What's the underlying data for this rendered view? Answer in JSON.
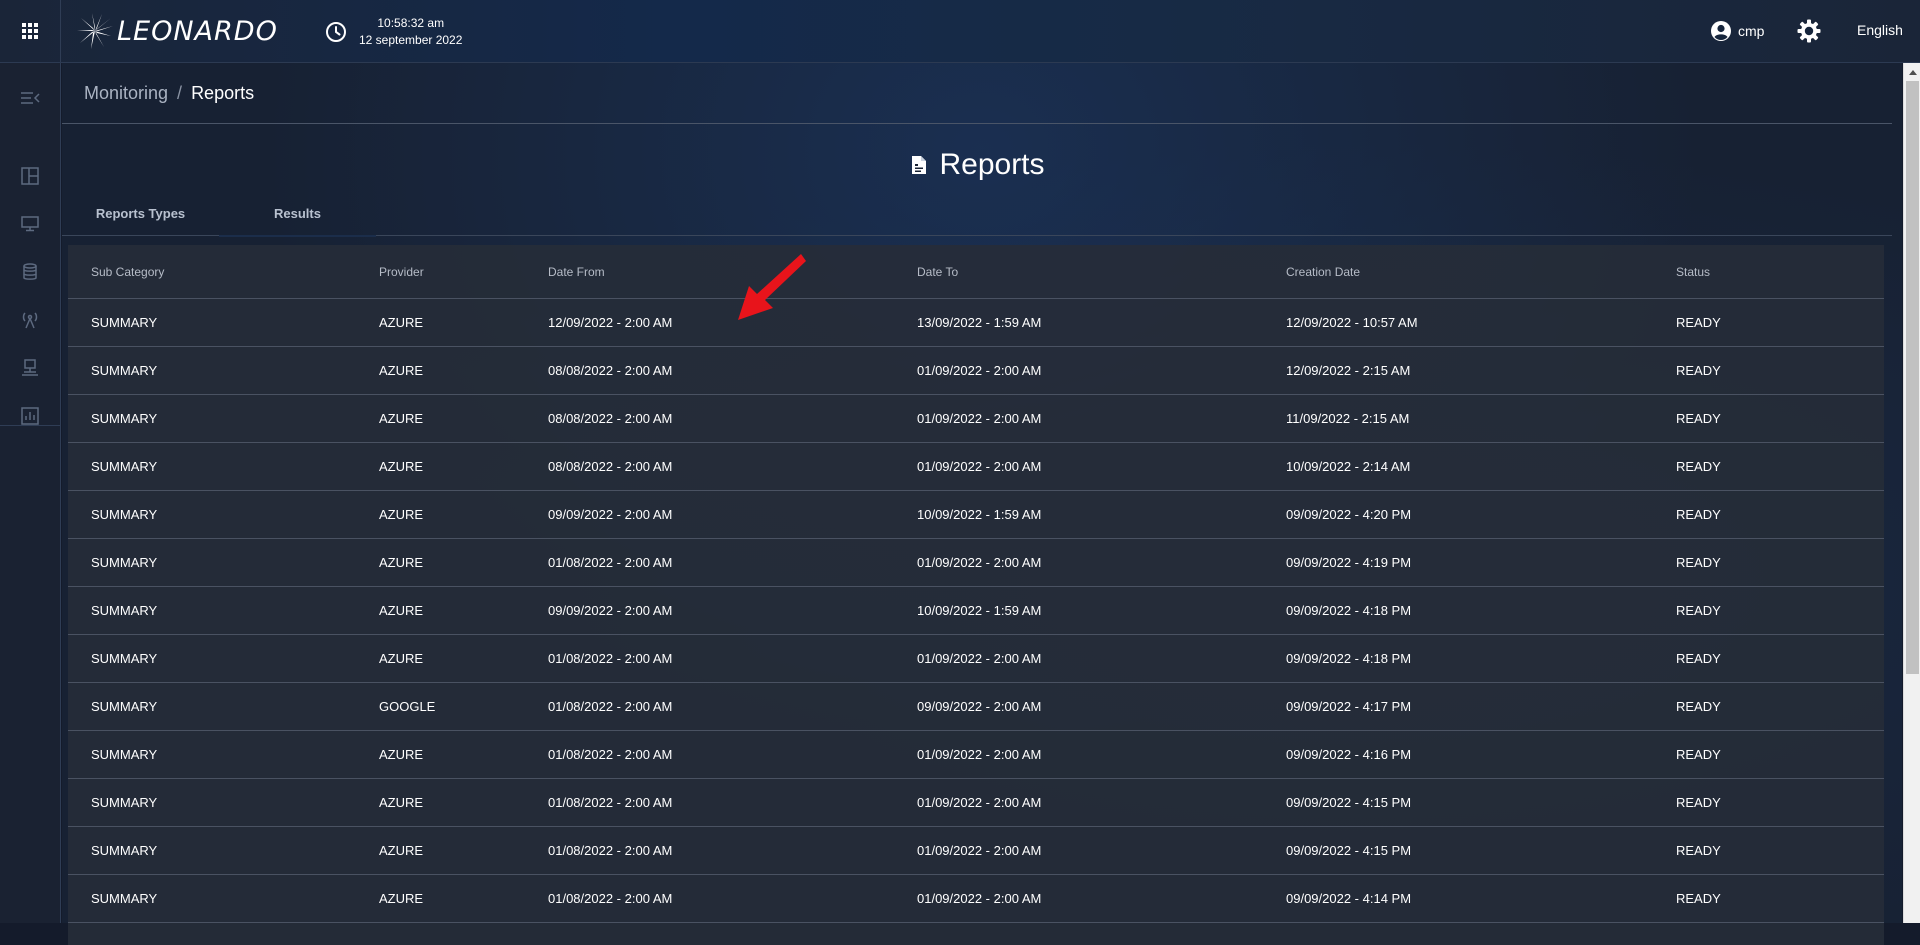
{
  "topbar": {
    "apps_icon": "apps-grid-icon",
    "logo_text": "LEONARDO",
    "clock": {
      "time": "10:58:32 am",
      "date": "12 september 2022"
    },
    "user": {
      "name": "cmp"
    },
    "language": "English"
  },
  "sidebar": {
    "items": [
      {
        "icon": "menu-collapse-icon"
      },
      {
        "icon": "dashboard-icon"
      },
      {
        "icon": "monitor-icon"
      },
      {
        "icon": "database-icon"
      },
      {
        "icon": "antenna-icon"
      },
      {
        "icon": "network-icon"
      },
      {
        "icon": "report-icon"
      }
    ]
  },
  "breadcrumb": {
    "parent": "Monitoring",
    "separator": "/",
    "current": "Reports"
  },
  "page": {
    "title": "Reports"
  },
  "tabs": [
    {
      "label": "Reports Types"
    },
    {
      "label": "Results",
      "active": true
    }
  ],
  "table": {
    "headers": [
      "Sub Category",
      "Provider",
      "Date From",
      "Date To",
      "Creation Date",
      "Status"
    ],
    "rows": [
      [
        "SUMMARY",
        "AZURE",
        "12/09/2022 - 2:00 AM",
        "13/09/2022 - 1:59 AM",
        "12/09/2022 - 10:57 AM",
        "READY"
      ],
      [
        "SUMMARY",
        "AZURE",
        "08/08/2022 - 2:00 AM",
        "01/09/2022 - 2:00 AM",
        "12/09/2022 - 2:15 AM",
        "READY"
      ],
      [
        "SUMMARY",
        "AZURE",
        "08/08/2022 - 2:00 AM",
        "01/09/2022 - 2:00 AM",
        "11/09/2022 - 2:15 AM",
        "READY"
      ],
      [
        "SUMMARY",
        "AZURE",
        "08/08/2022 - 2:00 AM",
        "01/09/2022 - 2:00 AM",
        "10/09/2022 - 2:14 AM",
        "READY"
      ],
      [
        "SUMMARY",
        "AZURE",
        "09/09/2022 - 2:00 AM",
        "10/09/2022 - 1:59 AM",
        "09/09/2022 - 4:20 PM",
        "READY"
      ],
      [
        "SUMMARY",
        "AZURE",
        "01/08/2022 - 2:00 AM",
        "01/09/2022 - 2:00 AM",
        "09/09/2022 - 4:19 PM",
        "READY"
      ],
      [
        "SUMMARY",
        "AZURE",
        "09/09/2022 - 2:00 AM",
        "10/09/2022 - 1:59 AM",
        "09/09/2022 - 4:18 PM",
        "READY"
      ],
      [
        "SUMMARY",
        "AZURE",
        "01/08/2022 - 2:00 AM",
        "01/09/2022 - 2:00 AM",
        "09/09/2022 - 4:18 PM",
        "READY"
      ],
      [
        "SUMMARY",
        "GOOGLE",
        "01/08/2022 - 2:00 AM",
        "09/09/2022 - 2:00 AM",
        "09/09/2022 - 4:17 PM",
        "READY"
      ],
      [
        "SUMMARY",
        "AZURE",
        "01/08/2022 - 2:00 AM",
        "01/09/2022 - 2:00 AM",
        "09/09/2022 - 4:16 PM",
        "READY"
      ],
      [
        "SUMMARY",
        "AZURE",
        "01/08/2022 - 2:00 AM",
        "01/09/2022 - 2:00 AM",
        "09/09/2022 - 4:15 PM",
        "READY"
      ],
      [
        "SUMMARY",
        "AZURE",
        "01/08/2022 - 2:00 AM",
        "01/09/2022 - 2:00 AM",
        "09/09/2022 - 4:15 PM",
        "READY"
      ],
      [
        "SUMMARY",
        "AZURE",
        "01/08/2022 - 2:00 AM",
        "01/09/2022 - 2:00 AM",
        "09/09/2022 - 4:14 PM",
        "READY"
      ]
    ]
  },
  "annotation": {
    "icon": "red-arrow-icon",
    "color": "#e8141b"
  },
  "colors": {
    "background": "#172133",
    "topbar": "#14294a",
    "table": "#262c38",
    "accent": "#ffffff"
  }
}
